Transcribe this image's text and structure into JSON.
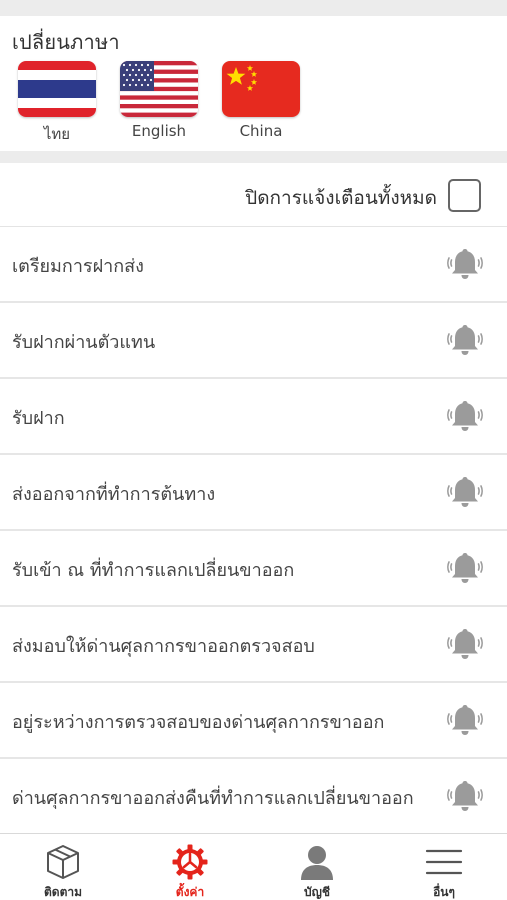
{
  "language": {
    "title": "เปลี่ยนภาษา",
    "options": [
      {
        "label": "ไทย",
        "flag": "thailand-flag"
      },
      {
        "label": "English",
        "flag": "usa-flag"
      },
      {
        "label": "China",
        "flag": "china-flag"
      }
    ]
  },
  "notifications": {
    "disable_all_label": "ปิดการแจ้งเตือนทั้งหมด",
    "disable_all_checked": false,
    "items": [
      {
        "label": "เตรียมการฝากส่ง"
      },
      {
        "label": "รับฝากผ่านตัวแทน"
      },
      {
        "label": "รับฝาก"
      },
      {
        "label": "ส่งออกจากที่ทำการต้นทาง"
      },
      {
        "label": "รับเข้า ณ ที่ทำการแลกเปลี่ยนขาออก"
      },
      {
        "label": "ส่งมอบให้ด่านศุลกากรขาออกตรวจสอบ"
      },
      {
        "label": "อยู่ระหว่างการตรวจสอบของด่านศุลกากรขาออก"
      },
      {
        "label": "ด่านศุลกากรขาออกส่งคืนที่ทำการแลกเปลี่ยนขาออก"
      }
    ]
  },
  "tabbar": {
    "tabs": [
      {
        "label": "ติดตาม",
        "icon": "package-icon"
      },
      {
        "label": "ตั้งค่า",
        "icon": "gear-icon",
        "active": true
      },
      {
        "label": "บัญชี",
        "icon": "user-icon"
      },
      {
        "label": "อื่นๆ",
        "icon": "menu-icon"
      }
    ]
  },
  "colors": {
    "accent": "#e4241b",
    "icon_gray": "#9b9b9b"
  }
}
